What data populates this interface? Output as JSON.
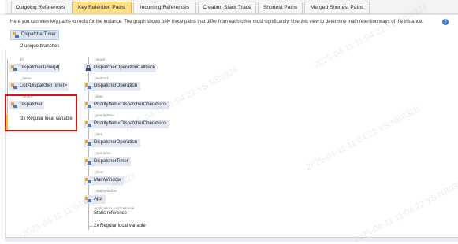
{
  "tabs": [
    {
      "label": "Outgoing References",
      "active": false
    },
    {
      "label": "Key Retention Paths",
      "active": true
    },
    {
      "label": "Incoming References",
      "active": false
    },
    {
      "label": "Creation Stack Trace",
      "active": false
    },
    {
      "label": "Shortest Paths",
      "active": false
    },
    {
      "label": "Merged Shortest Paths",
      "active": false
    }
  ],
  "description": "Here you can view key paths to roots for the instance. The graph shows only those paths that differ from each other most significantly. Use this view to determine main retention ways of the instance.",
  "help_icon": "?",
  "root": {
    "label": "DispatcherTimer",
    "icon": "class-icon"
  },
  "branches_summary": "2 unique branches",
  "left_branch": {
    "nodes": [
      {
        "field": "[0]",
        "label": "DispatcherTimer[4]"
      },
      {
        "field": "_items",
        "label": "List<DispatcherTimer>"
      },
      {
        "field": "_timers",
        "label": "Dispatcher"
      }
    ],
    "terminal": "3x Regular local variable"
  },
  "right_branch": {
    "nodes": [
      {
        "field": "_target",
        "label": "DispatcherOperationCallback",
        "icon": "lock-icon"
      },
      {
        "field": "_method",
        "label": "DispatcherOperation"
      },
      {
        "field": "_data",
        "label": "PriorityItem<DispatcherOperation>"
      },
      {
        "field": "_priorityPrev",
        "label": "PriorityItem<DispatcherOperation>"
      },
      {
        "field": "_item",
        "label": "DispatcherOperation"
      },
      {
        "field": "_operation",
        "label": "DispatcherTimer"
      },
      {
        "field": "_timer",
        "label": "MainWindow"
      },
      {
        "field": "_mainWindow",
        "label": "App"
      }
    ],
    "app_field": "Application._appInstance",
    "static_ref": "Static reference",
    "terminal": "2x Regular local variable"
  },
  "watermark": "2025-04-11 11:04:22 YS NB0328",
  "colors": {
    "active_tab": "#ffe08a",
    "node_bg": "#e3e8f2",
    "highlight": "#e01010",
    "marker": "#f4c430"
  }
}
